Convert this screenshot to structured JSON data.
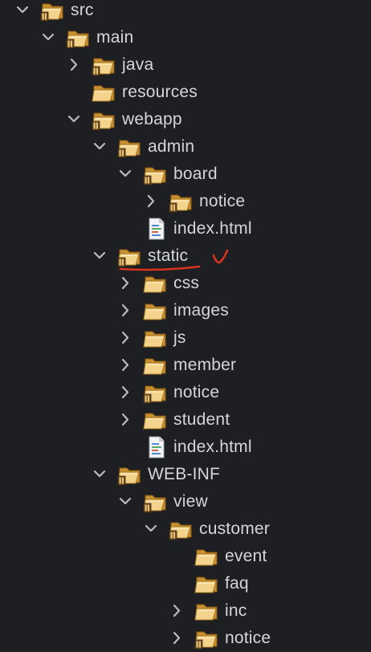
{
  "tree": [
    {
      "label": "src",
      "level": 0,
      "chevron": "expanded",
      "icon": "package-folder-icon"
    },
    {
      "label": "main",
      "level": 1,
      "chevron": "expanded",
      "icon": "package-folder-icon"
    },
    {
      "label": "java",
      "level": 2,
      "chevron": "collapsed",
      "icon": "package-folder-icon"
    },
    {
      "label": "resources",
      "level": 2,
      "chevron": "none",
      "icon": "folder-icon"
    },
    {
      "label": "webapp",
      "level": 2,
      "chevron": "expanded",
      "icon": "package-folder-icon"
    },
    {
      "label": "admin",
      "level": 3,
      "chevron": "expanded",
      "icon": "package-folder-icon"
    },
    {
      "label": "board",
      "level": 4,
      "chevron": "expanded",
      "icon": "package-folder-icon"
    },
    {
      "label": "notice",
      "level": 5,
      "chevron": "collapsed",
      "icon": "package-folder-icon"
    },
    {
      "label": "index.html",
      "level": 4,
      "chevron": "none",
      "icon": "html-file-icon"
    },
    {
      "label": "static",
      "level": 3,
      "chevron": "expanded",
      "icon": "package-folder-icon",
      "annotated": true
    },
    {
      "label": "css",
      "level": 4,
      "chevron": "collapsed",
      "icon": "folder-icon"
    },
    {
      "label": "images",
      "level": 4,
      "chevron": "collapsed",
      "icon": "folder-icon"
    },
    {
      "label": "js",
      "level": 4,
      "chevron": "collapsed",
      "icon": "folder-icon"
    },
    {
      "label": "member",
      "level": 4,
      "chevron": "collapsed",
      "icon": "folder-icon"
    },
    {
      "label": "notice",
      "level": 4,
      "chevron": "collapsed",
      "icon": "package-folder-icon"
    },
    {
      "label": "student",
      "level": 4,
      "chevron": "collapsed",
      "icon": "folder-icon"
    },
    {
      "label": "index.html",
      "level": 4,
      "chevron": "none",
      "icon": "html-file-icon"
    },
    {
      "label": "WEB-INF",
      "level": 3,
      "chevron": "expanded",
      "icon": "package-folder-icon"
    },
    {
      "label": "view",
      "level": 4,
      "chevron": "expanded",
      "icon": "package-folder-icon"
    },
    {
      "label": "customer",
      "level": 5,
      "chevron": "expanded",
      "icon": "package-folder-icon"
    },
    {
      "label": "event",
      "level": 6,
      "chevron": "none",
      "icon": "folder-icon"
    },
    {
      "label": "faq",
      "level": 6,
      "chevron": "none",
      "icon": "folder-icon"
    },
    {
      "label": "inc",
      "level": 6,
      "chevron": "collapsed",
      "icon": "folder-icon"
    },
    {
      "label": "notice",
      "level": 6,
      "chevron": "collapsed",
      "icon": "package-folder-icon"
    }
  ],
  "colors": {
    "background": "#1e1f22",
    "text": "#d6d6d6",
    "chevron": "#bcbcbc",
    "folder_light": "#f4d38c",
    "folder_dark": "#c8902e",
    "package_badge": "#6b4a1e",
    "annotation": "#d9321f"
  }
}
